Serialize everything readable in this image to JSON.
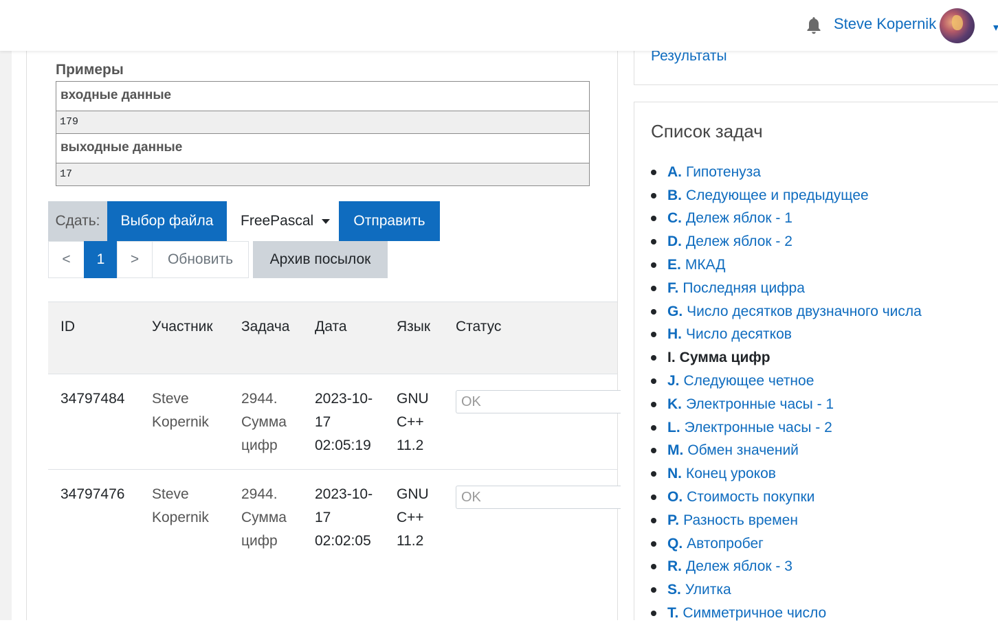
{
  "navbar": {
    "user_name": "Steve Kopernik"
  },
  "samples": {
    "title": "Примеры",
    "input_header": "входные данные",
    "input_value": "179",
    "output_header": "выходные данные",
    "output_value": "17"
  },
  "submit": {
    "label": "Сдать:",
    "file_button": "Выбор файла",
    "language": "FreePascal",
    "send_button": "Отправить"
  },
  "pager": {
    "prev": "<",
    "current": "1",
    "next": ">",
    "refresh": "Обновить",
    "archive": "Архив посылок"
  },
  "table": {
    "headers": [
      "ID",
      "Участник",
      "Задача",
      "Дата",
      "Язык",
      "Статус"
    ],
    "rows": [
      {
        "id": "34797484",
        "user": "Steve Kopernik",
        "task": "2944. Сумма цифр",
        "date": "2023-10-17 02:05:19",
        "lang": "GNU C++ 11.2",
        "status": "OK"
      },
      {
        "id": "34797476",
        "user": "Steve Kopernik",
        "task": "2944. Сумма цифр",
        "date": "2023-10-17 02:02:05",
        "lang": "GNU C++ 11.2",
        "status": "OK"
      }
    ]
  },
  "sidebar": {
    "results_link": "Результаты",
    "tasks_title": "Список задач",
    "tasks": [
      {
        "letter": "A.",
        "name": "Гипотенуза"
      },
      {
        "letter": "B.",
        "name": "Следующее и предыдущее"
      },
      {
        "letter": "C.",
        "name": "Дележ яблок - 1"
      },
      {
        "letter": "D.",
        "name": "Дележ яблок - 2"
      },
      {
        "letter": "E.",
        "name": "МКАД"
      },
      {
        "letter": "F.",
        "name": "Последняя цифра"
      },
      {
        "letter": "G.",
        "name": "Число десятков двузначного числа"
      },
      {
        "letter": "H.",
        "name": "Число десятков"
      },
      {
        "letter": "I.",
        "name": "Сумма цифр"
      },
      {
        "letter": "J.",
        "name": "Следующее четное"
      },
      {
        "letter": "K.",
        "name": "Электронные часы - 1"
      },
      {
        "letter": "L.",
        "name": "Электронные часы - 2"
      },
      {
        "letter": "M.",
        "name": "Обмен значений"
      },
      {
        "letter": "N.",
        "name": "Конец уроков"
      },
      {
        "letter": "O.",
        "name": "Стоимость покупки"
      },
      {
        "letter": "P.",
        "name": "Разность времен"
      },
      {
        "letter": "Q.",
        "name": "Автопробег"
      },
      {
        "letter": "R.",
        "name": "Дележ яблок - 3"
      },
      {
        "letter": "S.",
        "name": "Улитка"
      },
      {
        "letter": "T.",
        "name": "Симметричное число"
      }
    ],
    "active_task": "I."
  },
  "colors": {
    "brand_blue": "#0f6cbf",
    "secondary_grey": "#ced4da"
  }
}
